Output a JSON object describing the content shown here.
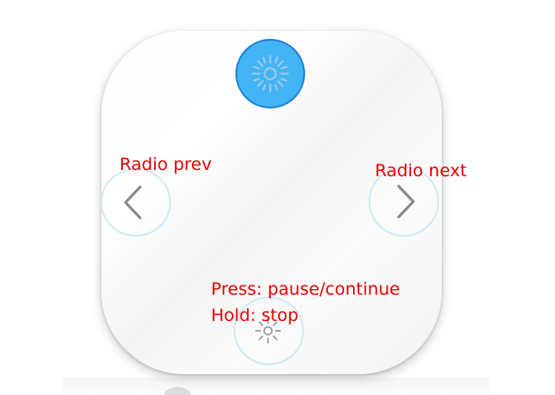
{
  "remote": {
    "buttons": {
      "top": {
        "icon": "sun-icon",
        "state": "active",
        "accent": "#43b4f4"
      },
      "left": {
        "icon": "chevron-left-icon"
      },
      "right": {
        "icon": "chevron-right-icon"
      },
      "bottom": {
        "icon": "sun-icon"
      }
    }
  },
  "labels": {
    "prev": "Radio prev",
    "next": "Radio next",
    "press": "Press: pause/continue",
    "hold": "Hold: stop"
  },
  "colors": {
    "label": "#e60000",
    "active_button": "#43b4f4",
    "button_ring": "#cfeaf8"
  }
}
